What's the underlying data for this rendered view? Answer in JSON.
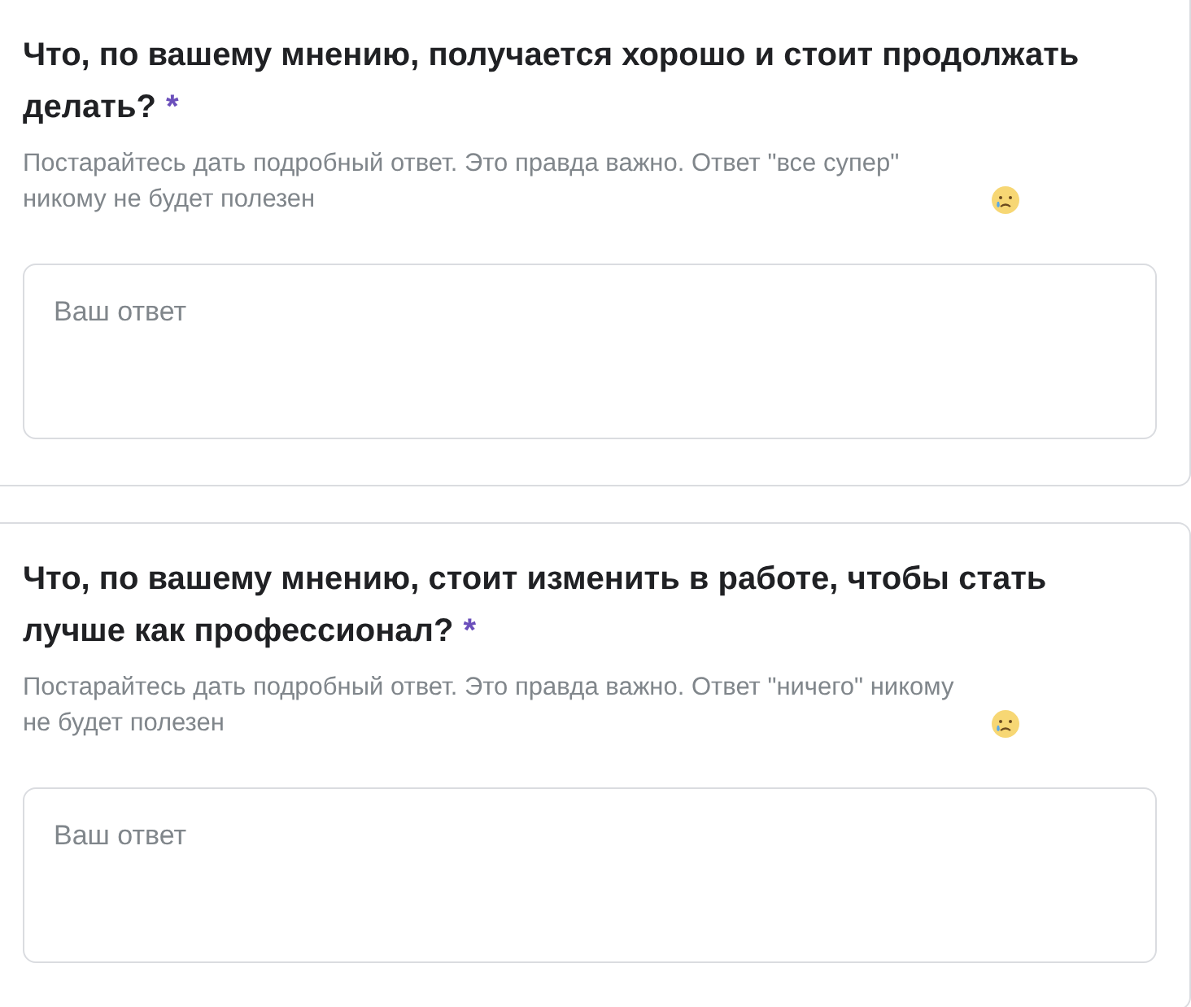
{
  "questions": [
    {
      "title": "Что, по вашему мнению, получается хорошо и стоит продолжать делать?",
      "required_mark": "*",
      "description": "Постарайтесь дать подробный ответ. Это правда важно. Ответ \"все супер\" никому не будет полезен",
      "answer_placeholder": "Ваш ответ"
    },
    {
      "title": "Что, по вашему мнению, стоит изменить в работе, чтобы стать лучше как профессионал?",
      "required_mark": "*",
      "description": "Постарайтесь дать подробный ответ. Это правда важно. Ответ \"ничего\" никому не будет полезен",
      "answer_placeholder": "Ваш ответ"
    }
  ]
}
